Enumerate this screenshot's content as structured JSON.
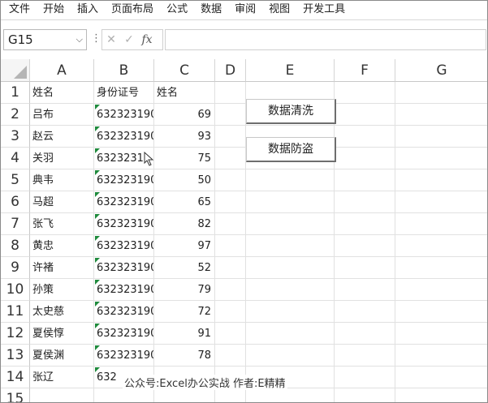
{
  "menu": [
    "文件",
    "开始",
    "插入",
    "页面布局",
    "公式",
    "数据",
    "审阅",
    "视图",
    "开发工具"
  ],
  "formula_bar": {
    "name_box": "G15",
    "cancel_glyph": "✕",
    "enter_glyph": "✓",
    "fx_label": "fx",
    "formula": ""
  },
  "columns": [
    "A",
    "B",
    "C",
    "D",
    "E",
    "F",
    "G"
  ],
  "rows": [
    {
      "n": "1",
      "a": "姓名",
      "b": "身份证号",
      "c": "姓名",
      "flag": false
    },
    {
      "n": "2",
      "a": "吕布",
      "b": "632323190",
      "c": "69",
      "flag": true
    },
    {
      "n": "3",
      "a": "赵云",
      "b": "632323190",
      "c": "93",
      "flag": true
    },
    {
      "n": "4",
      "a": "关羽",
      "b": "6323231",
      "c": "75",
      "flag": true
    },
    {
      "n": "5",
      "a": "典韦",
      "b": "632323190",
      "c": "50",
      "flag": true
    },
    {
      "n": "6",
      "a": "马超",
      "b": "632323190",
      "c": "65",
      "flag": true
    },
    {
      "n": "7",
      "a": "张飞",
      "b": "632323190",
      "c": "82",
      "flag": true
    },
    {
      "n": "8",
      "a": "黄忠",
      "b": "632323190",
      "c": "97",
      "flag": true
    },
    {
      "n": "9",
      "a": "许褚",
      "b": "632323190",
      "c": "52",
      "flag": true
    },
    {
      "n": "10",
      "a": "孙策",
      "b": "632323190",
      "c": "79",
      "flag": true
    },
    {
      "n": "11",
      "a": "太史慈",
      "b": "632323190",
      "c": "72",
      "flag": true
    },
    {
      "n": "12",
      "a": "夏侯惇",
      "b": "632323190",
      "c": "91",
      "flag": true
    },
    {
      "n": "13",
      "a": "夏侯渊",
      "b": "632323190",
      "c": "78",
      "flag": true
    },
    {
      "n": "14",
      "a": "张辽",
      "b": "632",
      "c": "",
      "flag": true
    },
    {
      "n": "15",
      "a": "",
      "b": "",
      "c": "",
      "flag": false
    }
  ],
  "buttons": {
    "clean": "数据清洗",
    "protect": "数据防盗"
  },
  "watermark": "公众号:Excel办公实战  作者:E精精",
  "colors": {
    "error_flag": "#1e8a3c"
  }
}
